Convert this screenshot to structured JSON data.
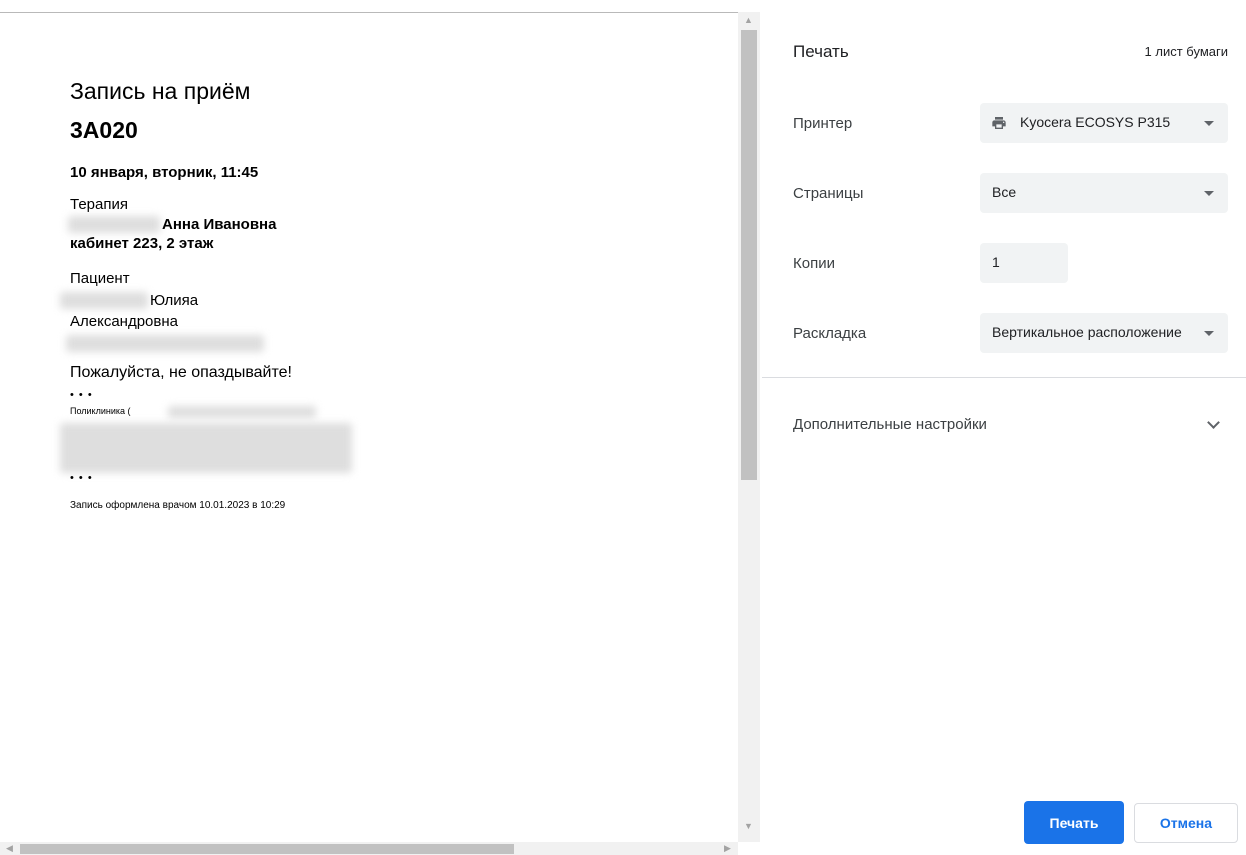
{
  "preview": {
    "title": "Запись на приём",
    "code": "3А020",
    "datetime": "10 января, вторник, 11:45",
    "specialty": "Терапия",
    "doctor": "Анна Ивановна",
    "room": "кабинет 223, 2 этаж",
    "patient_label": "Пациент",
    "patient_first_name": "Юлияа",
    "patient_middle_name": "Александровна",
    "notice": "Пожалуйста, не опаздывайте!",
    "separator": "• • •",
    "clinic": "Поликлиника (",
    "footer": "Запись оформлена врачом 10.01.2023 в 10:29"
  },
  "settings": {
    "title": "Печать",
    "sheets": "1 лист бумаги",
    "printer": {
      "label": "Принтер",
      "value": "Kyocera ECOSYS P315",
      "icon": "printer-icon"
    },
    "pages": {
      "label": "Страницы",
      "value": "Все"
    },
    "copies": {
      "label": "Копии",
      "value": "1"
    },
    "layout": {
      "label": "Раскладка",
      "value": "Вертикальное расположение"
    },
    "advanced": {
      "label": "Дополнительные настройки",
      "icon": "chevron-down-icon"
    },
    "print_button": "Печать",
    "cancel_button": "Отмена"
  },
  "colors": {
    "accent": "#1a73e8",
    "field_bg": "#f1f3f4",
    "divider": "#dadce0"
  }
}
